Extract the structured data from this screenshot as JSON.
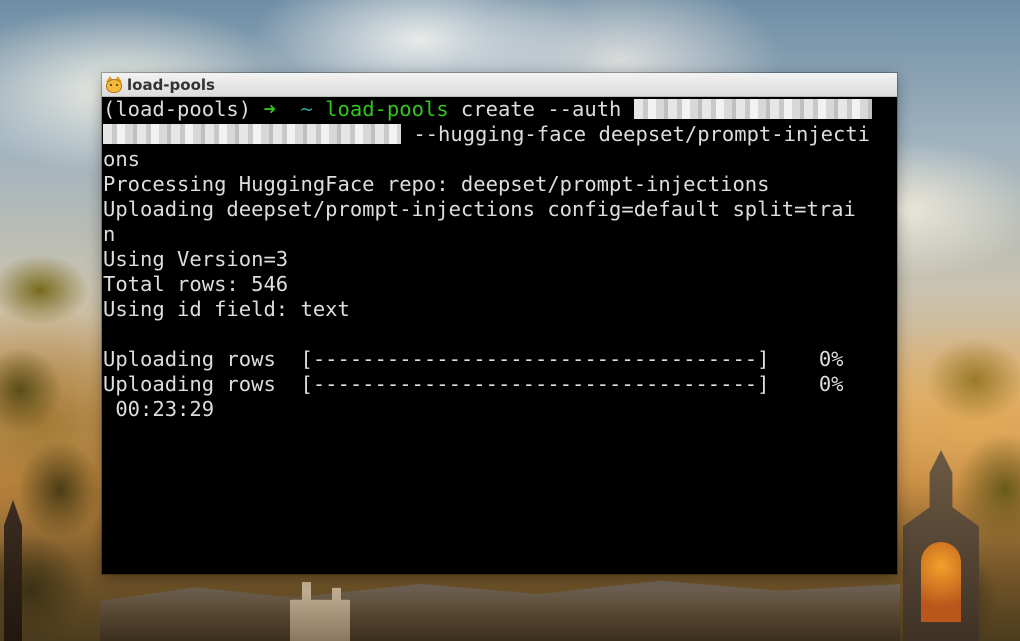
{
  "window": {
    "title": "load-pools",
    "icon": "cat-face-icon"
  },
  "terminal": {
    "prompt": {
      "env": "(load-pools)",
      "arrow": "➜",
      "cwd": "~",
      "command": "load-pools",
      "args": " create --auth "
    },
    "line2_tail": " --hugging-face deepset/prompt-injecti",
    "lines": [
      "ons",
      "Processing HuggingFace repo: deepset/prompt-injections",
      "Uploading deepset/prompt-injections config=default split=trai",
      "n",
      "Using Version=3",
      "Total rows: 546",
      "Using id field: text",
      "",
      "Uploading rows  [------------------------------------]    0%",
      "Uploading rows  [------------------------------------]    0%",
      " 00:23:29"
    ]
  },
  "colors": {
    "prompt_green": "#32c51d",
    "tilde_teal": "#2aa198",
    "terminal_bg": "#000000",
    "terminal_fg": "#dddddd"
  }
}
